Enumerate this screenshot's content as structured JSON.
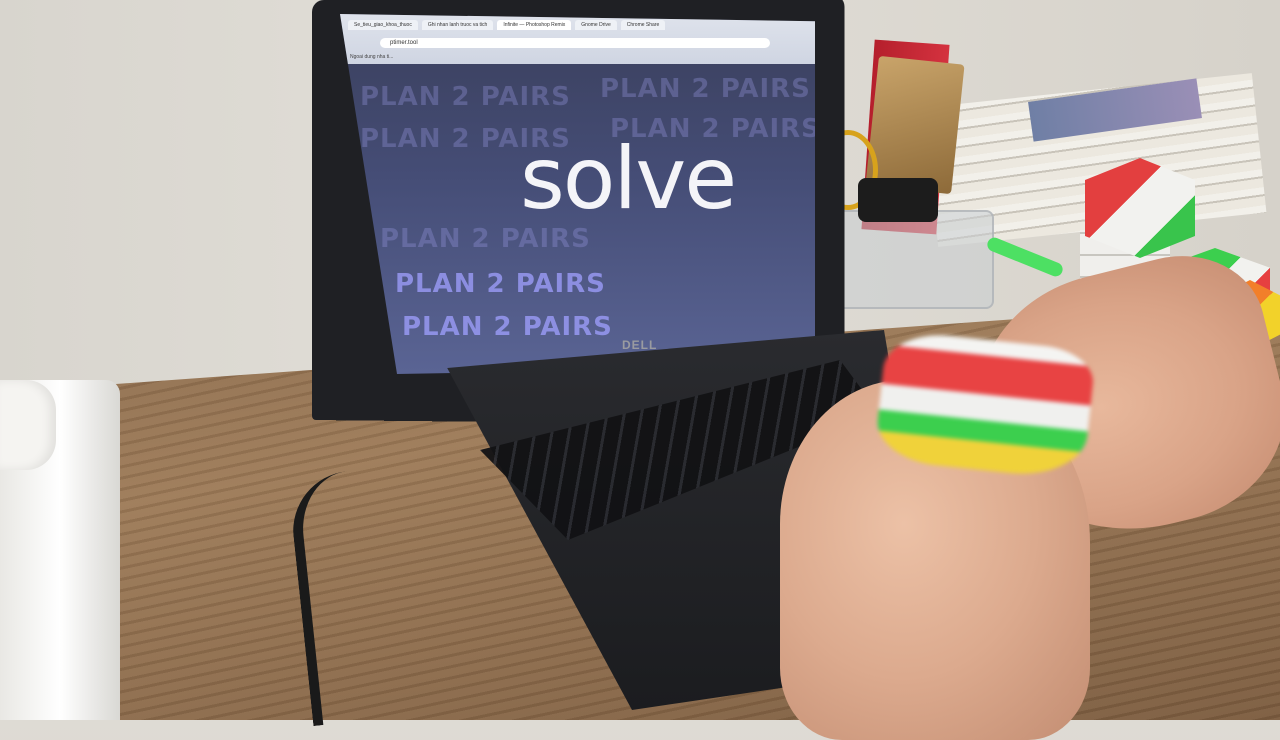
{
  "scene": {
    "description_label": "",
    "screen_text": {
      "main_word": "solve",
      "background_phrase": "PLAN 2 PAIRS"
    },
    "browser": {
      "tabs": [
        "Se_tieu_giao_khoa_thuoc",
        "Ghi nhan lanh truoc va tich",
        "Infinite — Photoshop Remix",
        "Gnome Drive",
        "Chrome Share"
      ],
      "url": "ptimer.tool",
      "bookmark": "Ngoai dung nha ti..."
    },
    "laptop_brand": "DELL"
  }
}
